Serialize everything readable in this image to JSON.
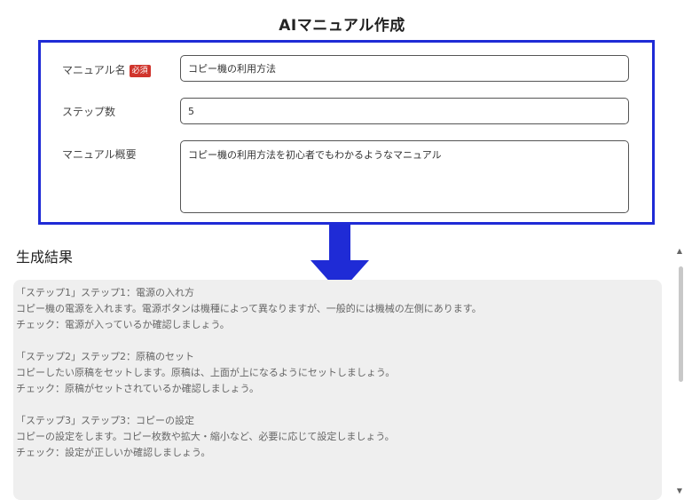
{
  "header": {
    "title": "AIマニュアル作成"
  },
  "form": {
    "manual_name": {
      "label": "マニュアル名",
      "required_badge": "必須",
      "value": "コピー機の利用方法"
    },
    "step_count": {
      "label": "ステップ数",
      "value": "5"
    },
    "overview": {
      "label": "マニュアル概要",
      "value": "コピー機の利用方法を初心者でもわかるようなマニュアル"
    }
  },
  "colors": {
    "form_border": "#1f2bd6",
    "arrow": "#1f2bd6",
    "required_badge": "#d0342c",
    "result_background": "#efefef"
  },
  "result": {
    "heading": "生成結果",
    "steps": [
      {
        "title": "「ステップ1」ステップ1：電源の入れ方",
        "body": "コピー機の電源を入れます。電源ボタンは機種によって異なりますが、一般的には機械の左側にあります。",
        "check": "チェック：電源が入っているか確認しましょう。"
      },
      {
        "title": "「ステップ2」ステップ2：原稿のセット",
        "body": "コピーしたい原稿をセットします。原稿は、上面が上になるようにセットしましょう。",
        "check": "チェック：原稿がセットされているか確認しましょう。"
      },
      {
        "title": "「ステップ3」ステップ3：コピーの設定",
        "body": "コピーの設定をします。コピー枚数や拡大・縮小など、必要に応じて設定しましょう。",
        "check": "チェック：設定が正しいか確認しましょう。"
      }
    ]
  }
}
